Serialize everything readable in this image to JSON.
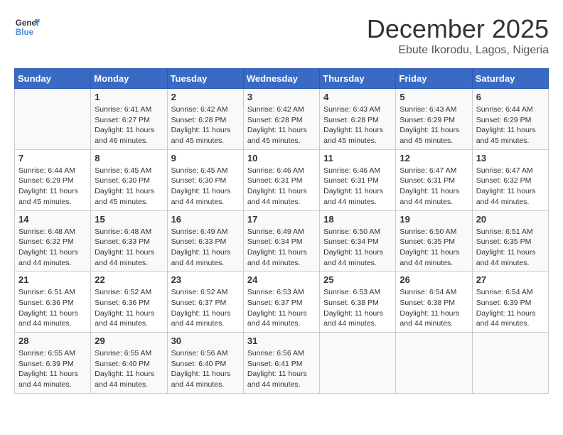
{
  "header": {
    "logo_line1": "General",
    "logo_line2": "Blue",
    "title": "December 2025",
    "subtitle": "Ebute Ikorodu, Lagos, Nigeria"
  },
  "columns": [
    "Sunday",
    "Monday",
    "Tuesday",
    "Wednesday",
    "Thursday",
    "Friday",
    "Saturday"
  ],
  "weeks": [
    [
      {
        "day": "",
        "sunrise": "",
        "sunset": "",
        "daylight": ""
      },
      {
        "day": "1",
        "sunrise": "Sunrise: 6:41 AM",
        "sunset": "Sunset: 6:27 PM",
        "daylight": "Daylight: 11 hours and 46 minutes."
      },
      {
        "day": "2",
        "sunrise": "Sunrise: 6:42 AM",
        "sunset": "Sunset: 6:28 PM",
        "daylight": "Daylight: 11 hours and 45 minutes."
      },
      {
        "day": "3",
        "sunrise": "Sunrise: 6:42 AM",
        "sunset": "Sunset: 6:28 PM",
        "daylight": "Daylight: 11 hours and 45 minutes."
      },
      {
        "day": "4",
        "sunrise": "Sunrise: 6:43 AM",
        "sunset": "Sunset: 6:28 PM",
        "daylight": "Daylight: 11 hours and 45 minutes."
      },
      {
        "day": "5",
        "sunrise": "Sunrise: 6:43 AM",
        "sunset": "Sunset: 6:29 PM",
        "daylight": "Daylight: 11 hours and 45 minutes."
      },
      {
        "day": "6",
        "sunrise": "Sunrise: 6:44 AM",
        "sunset": "Sunset: 6:29 PM",
        "daylight": "Daylight: 11 hours and 45 minutes."
      }
    ],
    [
      {
        "day": "7",
        "sunrise": "Sunrise: 6:44 AM",
        "sunset": "Sunset: 6:29 PM",
        "daylight": "Daylight: 11 hours and 45 minutes."
      },
      {
        "day": "8",
        "sunrise": "Sunrise: 6:45 AM",
        "sunset": "Sunset: 6:30 PM",
        "daylight": "Daylight: 11 hours and 45 minutes."
      },
      {
        "day": "9",
        "sunrise": "Sunrise: 6:45 AM",
        "sunset": "Sunset: 6:30 PM",
        "daylight": "Daylight: 11 hours and 44 minutes."
      },
      {
        "day": "10",
        "sunrise": "Sunrise: 6:46 AM",
        "sunset": "Sunset: 6:31 PM",
        "daylight": "Daylight: 11 hours and 44 minutes."
      },
      {
        "day": "11",
        "sunrise": "Sunrise: 6:46 AM",
        "sunset": "Sunset: 6:31 PM",
        "daylight": "Daylight: 11 hours and 44 minutes."
      },
      {
        "day": "12",
        "sunrise": "Sunrise: 6:47 AM",
        "sunset": "Sunset: 6:31 PM",
        "daylight": "Daylight: 11 hours and 44 minutes."
      },
      {
        "day": "13",
        "sunrise": "Sunrise: 6:47 AM",
        "sunset": "Sunset: 6:32 PM",
        "daylight": "Daylight: 11 hours and 44 minutes."
      }
    ],
    [
      {
        "day": "14",
        "sunrise": "Sunrise: 6:48 AM",
        "sunset": "Sunset: 6:32 PM",
        "daylight": "Daylight: 11 hours and 44 minutes."
      },
      {
        "day": "15",
        "sunrise": "Sunrise: 6:48 AM",
        "sunset": "Sunset: 6:33 PM",
        "daylight": "Daylight: 11 hours and 44 minutes."
      },
      {
        "day": "16",
        "sunrise": "Sunrise: 6:49 AM",
        "sunset": "Sunset: 6:33 PM",
        "daylight": "Daylight: 11 hours and 44 minutes."
      },
      {
        "day": "17",
        "sunrise": "Sunrise: 6:49 AM",
        "sunset": "Sunset: 6:34 PM",
        "daylight": "Daylight: 11 hours and 44 minutes."
      },
      {
        "day": "18",
        "sunrise": "Sunrise: 6:50 AM",
        "sunset": "Sunset: 6:34 PM",
        "daylight": "Daylight: 11 hours and 44 minutes."
      },
      {
        "day": "19",
        "sunrise": "Sunrise: 6:50 AM",
        "sunset": "Sunset: 6:35 PM",
        "daylight": "Daylight: 11 hours and 44 minutes."
      },
      {
        "day": "20",
        "sunrise": "Sunrise: 6:51 AM",
        "sunset": "Sunset: 6:35 PM",
        "daylight": "Daylight: 11 hours and 44 minutes."
      }
    ],
    [
      {
        "day": "21",
        "sunrise": "Sunrise: 6:51 AM",
        "sunset": "Sunset: 6:36 PM",
        "daylight": "Daylight: 11 hours and 44 minutes."
      },
      {
        "day": "22",
        "sunrise": "Sunrise: 6:52 AM",
        "sunset": "Sunset: 6:36 PM",
        "daylight": "Daylight: 11 hours and 44 minutes."
      },
      {
        "day": "23",
        "sunrise": "Sunrise: 6:52 AM",
        "sunset": "Sunset: 6:37 PM",
        "daylight": "Daylight: 11 hours and 44 minutes."
      },
      {
        "day": "24",
        "sunrise": "Sunrise: 6:53 AM",
        "sunset": "Sunset: 6:37 PM",
        "daylight": "Daylight: 11 hours and 44 minutes."
      },
      {
        "day": "25",
        "sunrise": "Sunrise: 6:53 AM",
        "sunset": "Sunset: 6:38 PM",
        "daylight": "Daylight: 11 hours and 44 minutes."
      },
      {
        "day": "26",
        "sunrise": "Sunrise: 6:54 AM",
        "sunset": "Sunset: 6:38 PM",
        "daylight": "Daylight: 11 hours and 44 minutes."
      },
      {
        "day": "27",
        "sunrise": "Sunrise: 6:54 AM",
        "sunset": "Sunset: 6:39 PM",
        "daylight": "Daylight: 11 hours and 44 minutes."
      }
    ],
    [
      {
        "day": "28",
        "sunrise": "Sunrise: 6:55 AM",
        "sunset": "Sunset: 6:39 PM",
        "daylight": "Daylight: 11 hours and 44 minutes."
      },
      {
        "day": "29",
        "sunrise": "Sunrise: 6:55 AM",
        "sunset": "Sunset: 6:40 PM",
        "daylight": "Daylight: 11 hours and 44 minutes."
      },
      {
        "day": "30",
        "sunrise": "Sunrise: 6:56 AM",
        "sunset": "Sunset: 6:40 PM",
        "daylight": "Daylight: 11 hours and 44 minutes."
      },
      {
        "day": "31",
        "sunrise": "Sunrise: 6:56 AM",
        "sunset": "Sunset: 6:41 PM",
        "daylight": "Daylight: 11 hours and 44 minutes."
      },
      {
        "day": "",
        "sunrise": "",
        "sunset": "",
        "daylight": ""
      },
      {
        "day": "",
        "sunrise": "",
        "sunset": "",
        "daylight": ""
      },
      {
        "day": "",
        "sunrise": "",
        "sunset": "",
        "daylight": ""
      }
    ]
  ]
}
